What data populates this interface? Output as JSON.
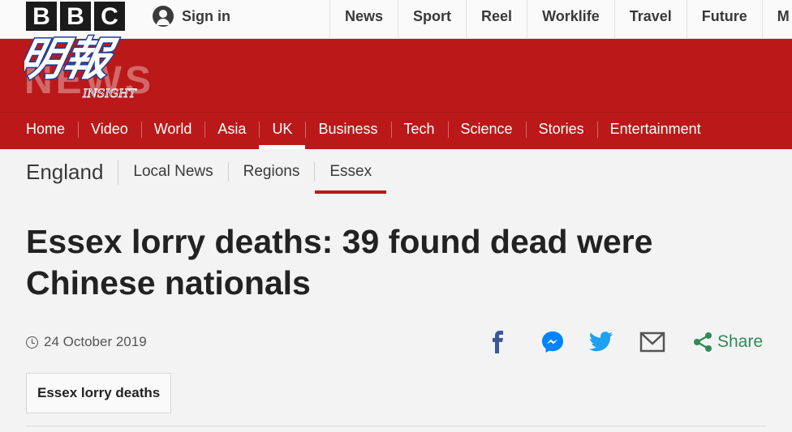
{
  "brand": {
    "letters": [
      "B",
      "B",
      "C"
    ],
    "news_wordmark": "NEWS"
  },
  "watermark": {
    "title": "明報",
    "subtitle": "INSIGHT"
  },
  "topbar": {
    "sign_in": "Sign in",
    "nav": [
      "News",
      "Sport",
      "Reel",
      "Worklife",
      "Travel",
      "Future",
      "M"
    ]
  },
  "main_nav": {
    "items": [
      "Home",
      "Video",
      "World",
      "Asia",
      "UK",
      "Business",
      "Tech",
      "Science",
      "Stories",
      "Entertainment"
    ],
    "active": "UK"
  },
  "sub_nav": {
    "section": "England",
    "items": [
      "Local News",
      "Regions",
      "Essex"
    ],
    "active": "Essex"
  },
  "article": {
    "headline": "Essex lorry deaths: 39 found dead were Chinese nationals",
    "date": "24 October 2019",
    "tag": "Essex lorry deaths"
  },
  "share": {
    "label": "Share",
    "icons": [
      "facebook-icon",
      "messenger-icon",
      "twitter-icon",
      "email-icon",
      "share-icon"
    ]
  },
  "colors": {
    "brand_red": "#bb1919",
    "facebook": "#3b5998",
    "messenger": "#0084ff",
    "twitter": "#1da1f2",
    "share_green": "#2e8b57"
  }
}
